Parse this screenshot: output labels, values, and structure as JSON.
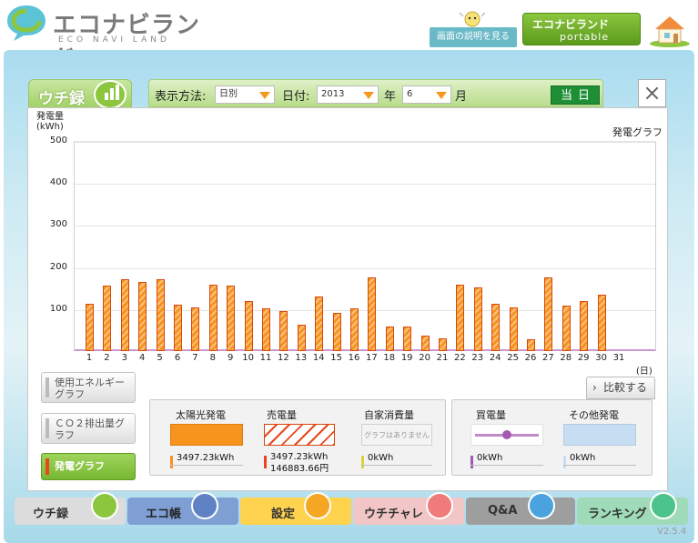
{
  "header": {
    "logo_text": "エコナビランド",
    "logo_sub": "ECO NAVI LAND",
    "help_label": "画面の説明を見る",
    "portable_title": "エコナビランド",
    "portable_sub": "portable"
  },
  "page": {
    "title": "ウチ録"
  },
  "controls": {
    "display_method_label": "表示方法:",
    "display_method_value": "日別",
    "date_label": "日付:",
    "year_value": "2013",
    "year_unit": "年",
    "month_value": "6",
    "month_unit": "月",
    "today_label": "当日",
    "close_label": "×"
  },
  "chart_data": {
    "type": "bar",
    "title": "発電グラフ",
    "ylabel": "発電量\n(kWh)",
    "xlabel": "(日)",
    "ylim": [
      0,
      500
    ],
    "yticks": [
      "500",
      "400",
      "300",
      "200",
      "100"
    ],
    "categories": [
      "1",
      "2",
      "3",
      "4",
      "5",
      "6",
      "7",
      "8",
      "9",
      "10",
      "11",
      "12",
      "13",
      "14",
      "15",
      "16",
      "17",
      "18",
      "19",
      "20",
      "21",
      "22",
      "23",
      "24",
      "25",
      "26",
      "27",
      "28",
      "29",
      "30",
      "31"
    ],
    "series": [
      {
        "values": [
          112,
          155,
          172,
          165,
          171,
          111,
          105,
          158,
          156,
          120,
          102,
          95,
          62,
          129,
          90,
          102,
          176,
          58,
          58,
          37,
          30,
          158,
          151,
          113,
          103,
          29,
          175,
          108,
          120,
          134,
          0
        ]
      }
    ],
    "colors": {
      "bar": "#f7941d",
      "bar_stripe": "#f9c183",
      "bar_border": "#d9470a"
    }
  },
  "graph_buttons": [
    {
      "label": "使用エネルギーグラフ",
      "active": false
    },
    {
      "label": "ＣＯ２排出量グラフ",
      "active": false
    },
    {
      "label": "発電グラフ",
      "active": true
    }
  ],
  "compare_label": "比較する",
  "legend": {
    "solar": {
      "title": "太陽光発電",
      "value": "3497.23kWh"
    },
    "sold": {
      "title": "売電量",
      "value": "3497.23kWh",
      "yen": "146883.66円"
    },
    "self": {
      "title": "自家消費量",
      "placeholder": "グラフはありません",
      "value": "0kWh"
    },
    "bought": {
      "title": "買電量",
      "value": "0kWh"
    },
    "other": {
      "title": "その他発電",
      "value": "0kWh"
    }
  },
  "nav": [
    {
      "label": "ウチ録",
      "icon": "bar-chart-icon"
    },
    {
      "label": "エコ帳",
      "icon": "notebook-icon"
    },
    {
      "label": "設定",
      "icon": "wrench-icon"
    },
    {
      "label": "ウチチャレ",
      "icon": "flag-icon"
    },
    {
      "label": "Q&A",
      "icon": "question-icon"
    },
    {
      "label": "ランキング",
      "icon": "crown-icon"
    }
  ],
  "version": "V2.5.4"
}
